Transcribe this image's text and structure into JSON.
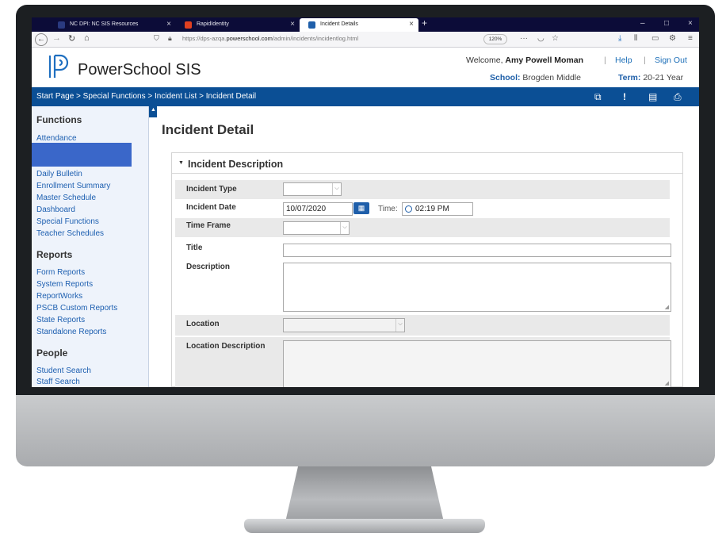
{
  "browser": {
    "tabs": [
      {
        "title": "NC DPI: NC SIS Resources",
        "active": false
      },
      {
        "title": "RapidIdentity",
        "active": false
      },
      {
        "title": "Incident Details",
        "active": true
      }
    ],
    "url_prefix": "https://dps-azqa.",
    "url_domain": "powerschool.com",
    "url_path": "/admin/incidents/incidentlog.html",
    "zoom": "120%"
  },
  "app": {
    "brand": "PowerSchool SIS",
    "welcome_prefix": "Welcome,",
    "user_name": "Amy Powell Moman",
    "help": "Help",
    "sign_out": "Sign Out",
    "school_label": "School:",
    "school_value": "Brogden Middle",
    "term_label": "Term:",
    "term_value": "20-21 Year"
  },
  "breadcrumb": "Start Page > Special Functions > Incident List > Incident Detail",
  "sidebar": {
    "functions_heading": "Functions",
    "functions": [
      "Attendance",
      "Daily Bulletin",
      "Enrollment Summary",
      "Master Schedule",
      "Dashboard",
      "Special Functions",
      "Teacher Schedules"
    ],
    "reports_heading": "Reports",
    "reports": [
      "Form Reports",
      "System Reports",
      "ReportWorks",
      "PSCB Custom Reports",
      "State Reports",
      "Standalone Reports"
    ],
    "people_heading": "People",
    "people": [
      "Student Search",
      "Staff Search"
    ]
  },
  "main": {
    "page_title": "Incident Detail",
    "section_title": "Incident Description",
    "fields": {
      "incident_type": "Incident Type",
      "incident_date": "Incident Date",
      "incident_date_value": "10/07/2020",
      "time_label": "Time:",
      "time_value": "02:19 PM",
      "time_frame": "Time Frame",
      "title": "Title",
      "description": "Description",
      "location": "Location",
      "location_description": "Location Description"
    }
  },
  "colors": {
    "nav_blue": "#0b4f95",
    "link_blue": "#1d5fb0",
    "sidebar_bg": "#eef3fb"
  }
}
